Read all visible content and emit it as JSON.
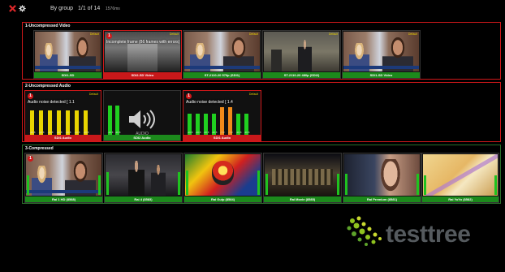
{
  "toolbar": {
    "group_label": "By group",
    "page_count": "1/1 of 14",
    "elapsed": "1576ms"
  },
  "groups": {
    "video": {
      "title": "1-Uncompressed Video",
      "tiles": [
        {
          "caption": "SDI1-SD",
          "default": "Default",
          "status": "ok"
        },
        {
          "caption": "SDI2-SD Video",
          "default": "Default",
          "status": "alarm",
          "badge": "1",
          "alarm": "Incomplete frame (86 frames with errors)"
        },
        {
          "caption": "ST-2110-20 576p (SDI1)",
          "default": "Default",
          "status": "ok"
        },
        {
          "caption": "ST-2110-20 480p (SDI2)",
          "default": "Default",
          "status": "ok"
        },
        {
          "caption": "SDI1-SD Video",
          "default": "Default",
          "status": "ok"
        }
      ]
    },
    "audio": {
      "title": "2-Uncompressed Audio",
      "tiles": [
        {
          "caption": "SDI1 Audio",
          "default": "Default",
          "status": "alarm",
          "badge": "1",
          "alarm": "Audio noise detected [ 1.1",
          "db": [
            "-20.8",
            "-20.8",
            "-20.8",
            "-20.8",
            "-20.8",
            "-20.8",
            "-20.8"
          ]
        },
        {
          "caption": "SDI2 Audio",
          "default": "",
          "status": "ok",
          "audio_word": "AUDIO",
          "db": [
            "-20.8",
            "-20.8"
          ]
        },
        {
          "caption": "SDI1 Audio",
          "default": "Default",
          "status": "alarm",
          "badge": "1",
          "alarm": "Audio noise detected [ 1.4",
          "db": [
            "-20.8",
            "-20.8",
            "-20.8",
            "-20.8",
            "-7.3",
            "-7.3",
            "-20.8",
            "-20.8"
          ]
        }
      ]
    },
    "compressed": {
      "title": "3-Compressed",
      "tiles": [
        {
          "caption": "Rai 1 HD (8588)",
          "status": "ok",
          "badge": "1"
        },
        {
          "caption": "Rai 4 (8583)",
          "status": "ok"
        },
        {
          "caption": "Rai Gulp (8584)",
          "status": "ok"
        },
        {
          "caption": "Rai Movie (8585)",
          "status": "ok"
        },
        {
          "caption": "Rai Premium (8581)",
          "status": "ok"
        },
        {
          "caption": "Rai YoYo (8582)",
          "status": "ok"
        }
      ]
    }
  },
  "brand": {
    "logo_text": "testtree",
    "accent": "#c8181a",
    "ok": "#1c8a1c",
    "logo_dot_colors": [
      "#8fc31f",
      "#c9d82f",
      "#5da32a"
    ]
  }
}
